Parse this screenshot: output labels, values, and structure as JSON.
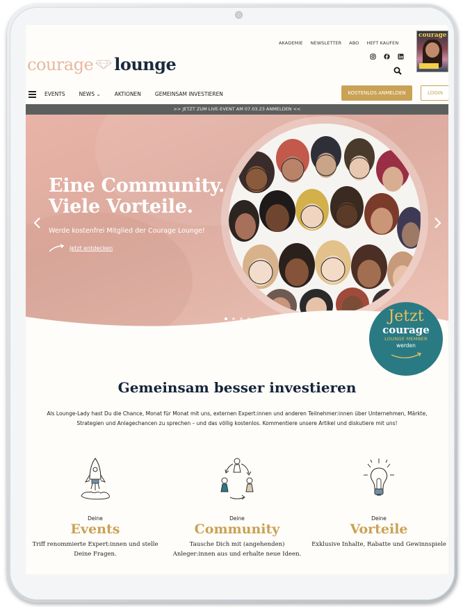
{
  "topnav": {
    "items": [
      "AKADEMIE",
      "NEWSLETTER",
      "ABO",
      "HEFT KAUFEN"
    ]
  },
  "logo": {
    "part1": "courage",
    "part2": "lounge"
  },
  "magazine": {
    "title": "courage"
  },
  "mainnav": {
    "items": [
      "EVENTS",
      "NEWS",
      "AKTIONEN",
      "GEMEINSAM INVESTIEREN"
    ],
    "news_chevron": "⌄"
  },
  "buttons": {
    "signup": "KOSTENLOS ANMELDEN",
    "login": "LOGIN"
  },
  "banner": {
    "text": ">> JETZT ZUM LIVE-EVENT AM 07.03.23 ANMELDEN <<"
  },
  "hero": {
    "title_line1": "Eine Community.",
    "title_line2": "Viele Vorteile.",
    "subtitle": "Werde kostenfrei Mitglied der Courage Lounge!",
    "cta": "Jetzt entdecken",
    "slides": 4,
    "active_slide": 1
  },
  "badge": {
    "line1": "Jetzt",
    "line2": "courage",
    "line3": "LOUNGE MEMBER",
    "line4": "werden"
  },
  "section": {
    "title": "Gemeinsam besser investieren",
    "text": "Als Lounge-Lady hast Du die Chance, Monat für Monat mit uns, externen Expert:innen und anderen Teilnehmer:innen über Unternehmen, Märkte, Strategien und Anlagechancen zu sprechen – und das völlig kostenlos. Kommentiere unsere Artikel und diskutiere mit uns!"
  },
  "features": [
    {
      "pre": "Deine",
      "title": "Events",
      "desc": "Triff renommierte Expert:innen und stelle Deine Fragen.",
      "icon": "rocket-icon"
    },
    {
      "pre": "Deine",
      "title": "Community",
      "desc": "Tausche Dich mit (angehenden) Anleger:innen aus und erhalte neue Ideen.",
      "icon": "community-icon"
    },
    {
      "pre": "Deine",
      "title": "Vorteile",
      "desc": "Exklusive Inhalte, Rabatte und Gewinnspiele",
      "icon": "lightbulb-icon"
    }
  ],
  "colors": {
    "gold": "#c9a255",
    "navy": "#15243a",
    "teal": "#2a7a84",
    "hero_pink": "#e3b2a6",
    "banner": "#5d5f5e"
  }
}
